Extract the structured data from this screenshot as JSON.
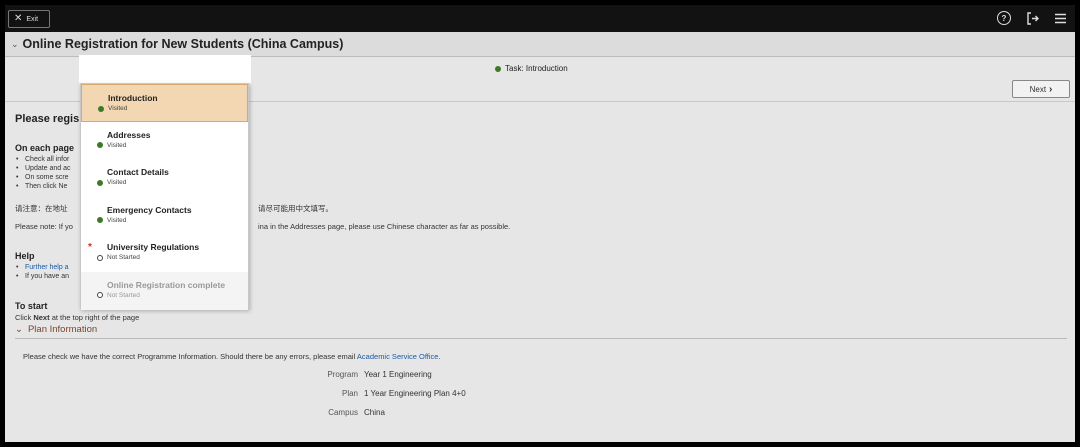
{
  "topbar": {
    "exit_label": "Exit",
    "icons": [
      "help-icon",
      "signout-icon",
      "menu-icon"
    ]
  },
  "page": {
    "title": "Online Registration for New Students (China Campus)",
    "task_label": "Task: Introduction",
    "next_label": "Next"
  },
  "content": {
    "heading_fragment": "Please regis",
    "on_each_page": "On each page",
    "bullets": [
      "Check all infor",
      "Update and ac",
      "On some scre",
      "Then click Ne"
    ],
    "chinese_note_fragment": "请注意：在地址",
    "chinese_note_tail": "请尽可能用中文填写。",
    "please_note_start": "Please note: If yo",
    "please_note_tail": "ina in the Addresses page, please use Chinese character as far as possible.",
    "help_heading": "Help",
    "help_bullets": [
      "Further help a",
      "If you have an"
    ],
    "to_start_heading": "To start",
    "to_start_text_prefix": "Click ",
    "to_start_text_bold": "Next",
    "to_start_text_suffix": " at the top right of the page",
    "plan_header": "Plan Information",
    "plan_intro": "Please check we have the correct Programme Information. Should there be any errors, please email ",
    "plan_intro_link": "Academic Service Office",
    "plan_intro_end": ".",
    "plan_rows": [
      {
        "label": "Program",
        "value": "Year 1 Engineering"
      },
      {
        "label": "Plan",
        "value": "1 Year Engineering Plan 4+0"
      },
      {
        "label": "Campus",
        "value": "China"
      }
    ]
  },
  "steps": [
    {
      "title": "Introduction",
      "status": "Visited",
      "state": "visited",
      "active": true,
      "required": false
    },
    {
      "title": "Addresses",
      "status": "Visited",
      "state": "visited",
      "active": false,
      "required": false
    },
    {
      "title": "Contact Details",
      "status": "Visited",
      "state": "visited",
      "active": false,
      "required": false
    },
    {
      "title": "Emergency Contacts",
      "status": "Visited",
      "state": "visited",
      "active": false,
      "required": false
    },
    {
      "title": "University Regulations",
      "status": "Not Started",
      "state": "not-started",
      "active": false,
      "required": true
    },
    {
      "title": "Online Registration complete",
      "status": "Not Started",
      "state": "not-started",
      "active": false,
      "required": false,
      "disabled": true
    }
  ],
  "colors": {
    "visited": "#3c7a28",
    "required": "#c0392b",
    "active_step": "#f3d7b2",
    "link": "#1a5aa8"
  }
}
